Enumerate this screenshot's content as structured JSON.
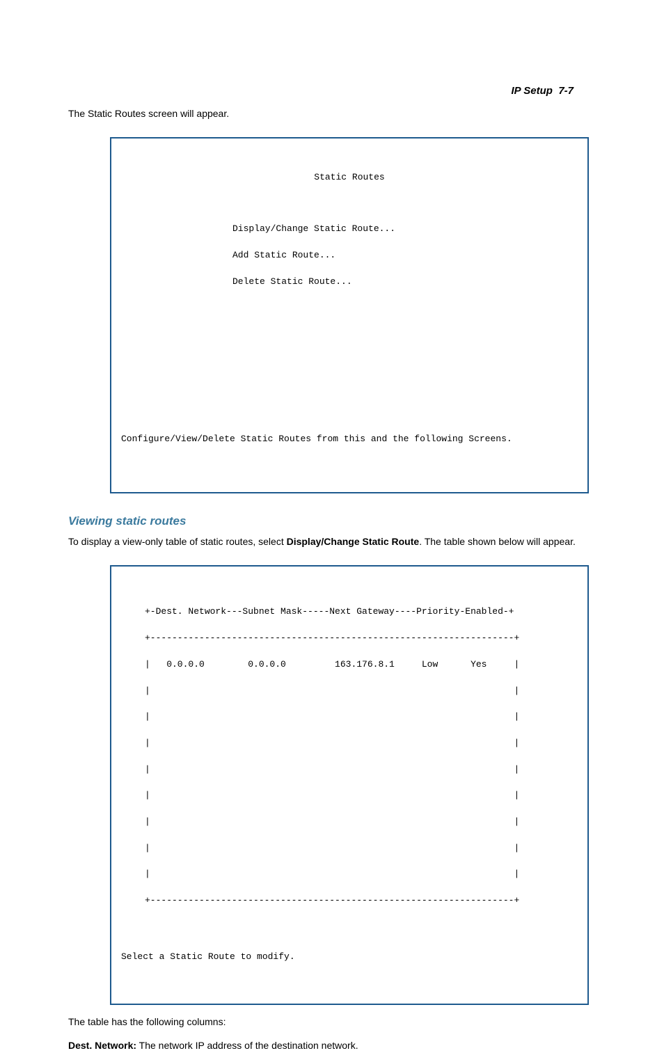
{
  "header": {
    "section": "IP Setup",
    "page": "7-7"
  },
  "intro1": "The Static Routes screen will appear.",
  "screen1": {
    "title": "Static Routes",
    "menu1": "Display/Change Static Route...",
    "menu2": "Add Static Route...",
    "menu3": "Delete Static Route...",
    "footer": "Configure/View/Delete Static Routes from this and the following Screens."
  },
  "heading": "Viewing static routes",
  "intro2_pre": "To display a view-only table of static routes, select ",
  "intro2_bold": "Display/Change Static Route",
  "intro2_post": ". The table shown below will appear.",
  "screen2": {
    "header_row": "+-Dest. Network---Subnet Mask-----Next Gateway----Priority-Enabled-+",
    "sep_top": "+-------------------------------------------------------------------+",
    "row1": "|   0.0.0.0        0.0.0.0         163.176.8.1     Low      Yes     |",
    "blank": "|                                                                   |",
    "sep_bot": "+-------------------------------------------------------------------+",
    "footer": "Select a Static Route to modify."
  },
  "col_intro": "The table has the following columns:",
  "col1_label": "Dest. Network:",
  "col1_desc": " The network IP address of the destination network.",
  "chart_data": {
    "type": "table",
    "title": "Static Routes",
    "columns": [
      "Dest. Network",
      "Subnet Mask",
      "Next Gateway",
      "Priority",
      "Enabled"
    ],
    "rows": [
      {
        "Dest. Network": "0.0.0.0",
        "Subnet Mask": "0.0.0.0",
        "Next Gateway": "163.176.8.1",
        "Priority": "Low",
        "Enabled": "Yes"
      }
    ]
  }
}
